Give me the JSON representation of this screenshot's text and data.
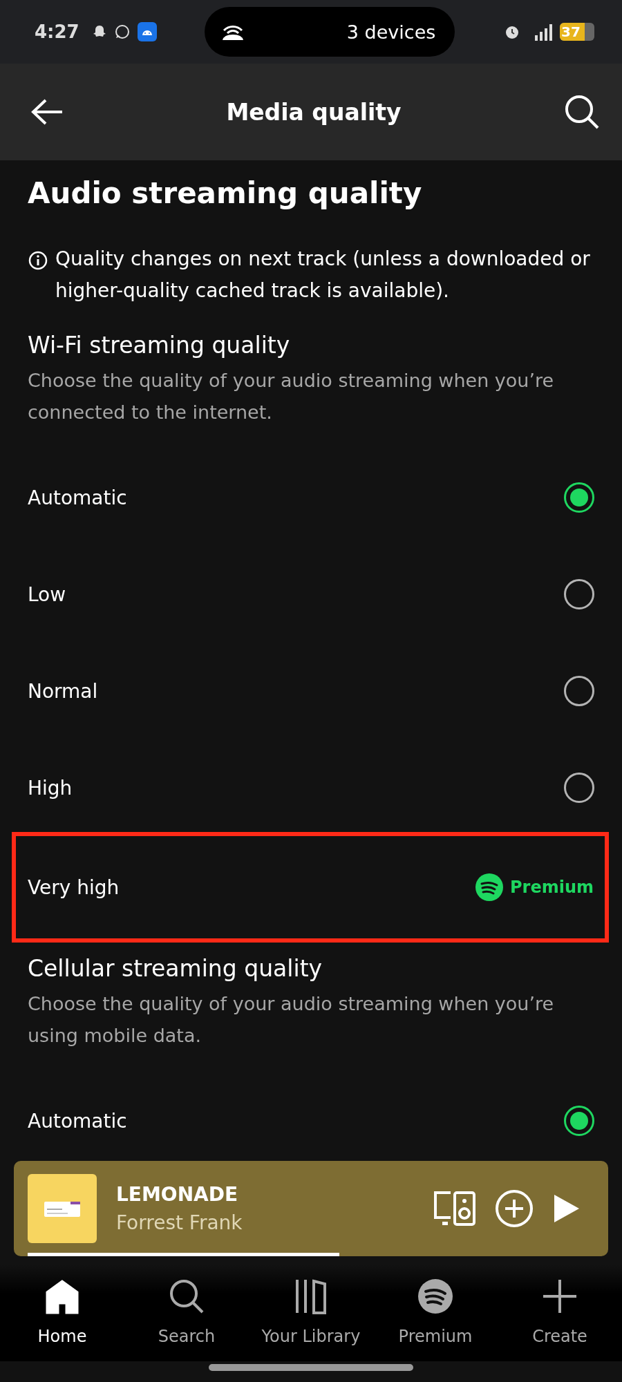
{
  "status_bar": {
    "time": "4:27",
    "hotspot": "3 devices",
    "battery": "37"
  },
  "header": {
    "title": "Media quality"
  },
  "section_title": "Audio streaming quality",
  "info": "Quality changes on next track (unless a downloaded or higher-quality cached track is available).",
  "groups": [
    {
      "title": "Wi-Fi streaming quality",
      "description": "Choose the quality of your audio streaming when you’re connected to the internet.",
      "options": [
        {
          "kind": "radio",
          "label": "Automatic",
          "selected": true,
          "highlighted": false
        },
        {
          "kind": "radio",
          "label": "Low",
          "selected": false,
          "highlighted": false
        },
        {
          "kind": "radio",
          "label": "Normal",
          "selected": false,
          "highlighted": false
        },
        {
          "kind": "radio",
          "label": "High",
          "selected": false,
          "highlighted": false
        },
        {
          "kind": "premium",
          "label": "Very high",
          "badge": "Premium",
          "highlighted": true
        }
      ]
    },
    {
      "title": "Cellular streaming quality",
      "description": "Choose the quality of your audio streaming when you’re using mobile data.",
      "options": [
        {
          "kind": "radio",
          "label": "Automatic",
          "selected": true,
          "highlighted": false
        }
      ]
    }
  ],
  "mini_player": {
    "title": "LEMONADE",
    "artist": "Forrest Frank",
    "level": 0.55
  },
  "nav": [
    {
      "label": "Home",
      "selected": true
    },
    {
      "label": "Search",
      "selected": false
    },
    {
      "label": "Your Library",
      "selected": false
    },
    {
      "label": "Premium",
      "selected": false
    },
    {
      "label": "Create",
      "selected": false
    }
  ]
}
